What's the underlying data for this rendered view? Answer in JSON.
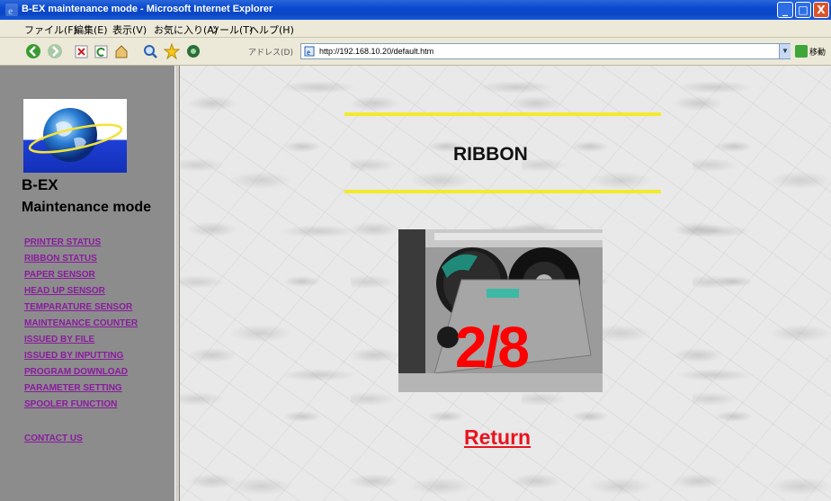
{
  "window": {
    "title": "B-EX maintenance mode - Microsoft Internet Explorer",
    "buttons": {
      "minimize": "_",
      "maximize": "□",
      "close": "X"
    }
  },
  "menu": [
    "ファイル(F)",
    "編集(E)",
    "表示(V)",
    "お気に入り(A)",
    "ツール(T)",
    "ヘルプ(H)"
  ],
  "toolbar": {
    "address_label": "アドレス(D)",
    "url": "http://192.168.10.20/default.htm",
    "go_label": "移動",
    "icons": [
      "back-icon",
      "forward-icon",
      "stop-icon",
      "refresh-icon",
      "home-icon",
      "search-icon",
      "favorites-icon",
      "media-icon"
    ]
  },
  "sidebar": {
    "brand_line1": "B-EX",
    "brand_line2": "Maintenance mode",
    "nav": [
      "PRINTER STATUS",
      "RIBBON STATUS",
      "PAPER SENSOR",
      "HEAD UP SENSOR",
      "TEMPARATURE SENSOR",
      "MAINTENANCE COUNTER",
      "ISSUED BY FILE",
      "ISSUED BY INPUTTING",
      "PROGRAM DOWNLOAD",
      "PARAMETER SETTING",
      "SPOOLER FUNCTION"
    ],
    "contact": "CONTACT US"
  },
  "main": {
    "title": "RIBBON",
    "step": "2/8",
    "return_label": "Return"
  },
  "colors": {
    "nav_link": "#8a1b9e",
    "accent_line": "#f2ea2c",
    "step_text": "#ff0000",
    "return_text": "#e8141e",
    "sidebar_bg": "#8c8c8c",
    "titlebar": "#0a4ad0"
  }
}
